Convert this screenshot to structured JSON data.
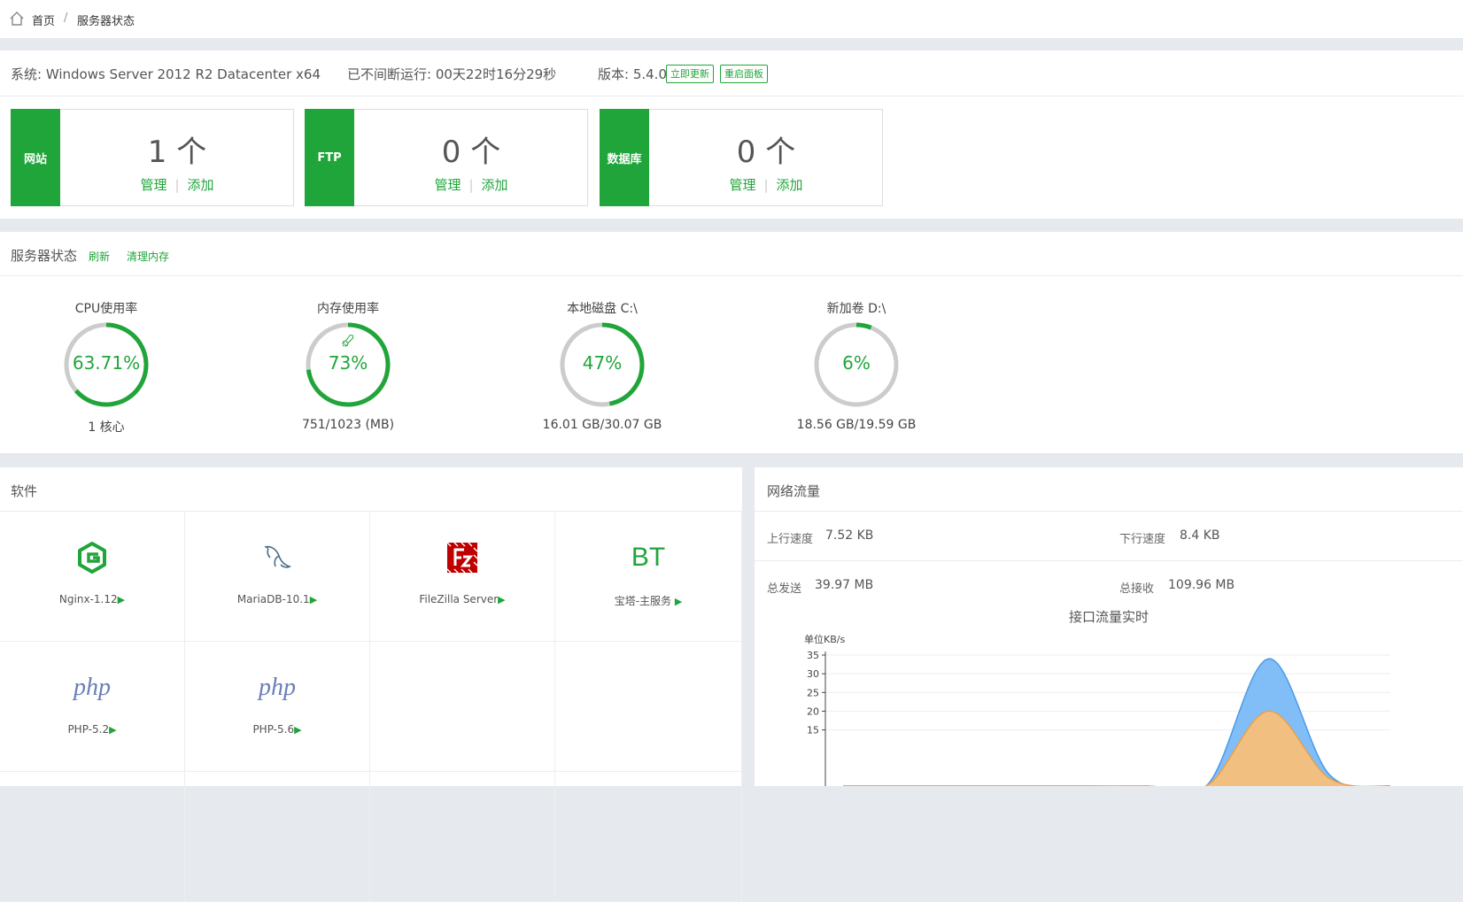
{
  "breadcrumb": {
    "home": "首页",
    "sep": "/",
    "current": "服务器状态"
  },
  "system": {
    "os": "系统: Windows Server 2012 R2 Datacenter x64",
    "uptime": "已不间断运行: 00天22时16分29秒",
    "version": "版本: 5.4.0",
    "update_btn": "立即更新",
    "restart_btn": "重启面板"
  },
  "counts": [
    {
      "label": "网站",
      "num": "1 个",
      "manage": "管理",
      "sep": "|",
      "add": "添加"
    },
    {
      "label": "FTP",
      "num": "0 个",
      "manage": "管理",
      "sep": "|",
      "add": "添加"
    },
    {
      "label": "数据库",
      "num": "0 个",
      "manage": "管理",
      "sep": "|",
      "add": "添加"
    }
  ],
  "status": {
    "title": "服务器状态",
    "refresh": "刷新",
    "clean": "清理内存",
    "gauges": [
      {
        "label": "CPU使用率",
        "pct_text": "63.71%",
        "value": 0.6371,
        "sub": "1 核心"
      },
      {
        "label": "内存使用率",
        "pct_text": "73%",
        "value": 0.73,
        "sub": "751/1023 (MB)"
      },
      {
        "label": "本地磁盘 C:\\",
        "pct_text": "47%",
        "value": 0.47,
        "sub": "16.01 GB/30.07 GB"
      },
      {
        "label": "新加卷 D:\\",
        "pct_text": "6%",
        "value": 0.06,
        "sub": "18.56 GB/19.59 GB"
      }
    ]
  },
  "software": {
    "title": "软件",
    "items": [
      {
        "name": "Nginx-1.12",
        "icon": "nginx-icon"
      },
      {
        "name": "MariaDB-10.1",
        "icon": "mariadb-icon"
      },
      {
        "name": "FileZilla Server",
        "icon": "filezilla-icon"
      },
      {
        "name": "宝塔-主服务 ",
        "icon": "bt-icon",
        "icon_text": "BT"
      },
      {
        "name": "PHP-5.2",
        "icon": "php-icon",
        "icon_text": "php"
      },
      {
        "name": "PHP-5.6",
        "icon": "php-icon",
        "icon_text": "php"
      }
    ]
  },
  "network": {
    "title": "网络流量",
    "up_label": "上行速度",
    "up_value": "7.52 KB",
    "down_label": "下行速度",
    "down_value": "8.4 KB",
    "sent_label": "总发送",
    "sent_value": "39.97 MB",
    "recv_label": "总接收",
    "recv_value": "109.96 MB"
  },
  "chart_data": {
    "type": "area",
    "title": "接口流量实时",
    "ylabel": "单位KB/s",
    "ylim": [
      0,
      35
    ],
    "yticks": [
      35,
      30,
      25,
      20,
      15
    ],
    "x": [
      0,
      1,
      2,
      3,
      4,
      5,
      6,
      7,
      8,
      9
    ],
    "series": [
      {
        "values": [
          0,
          0,
          0,
          0,
          0,
          0,
          0.5,
          34,
          3,
          0
        ],
        "color": "#7ab9f5"
      },
      {
        "values": [
          0,
          0,
          0,
          0,
          0,
          0,
          0.3,
          20,
          2,
          0
        ],
        "color": "#f7c07a"
      }
    ]
  },
  "colors": {
    "accent": "#20a53a",
    "ring_bg": "#cccccc"
  }
}
